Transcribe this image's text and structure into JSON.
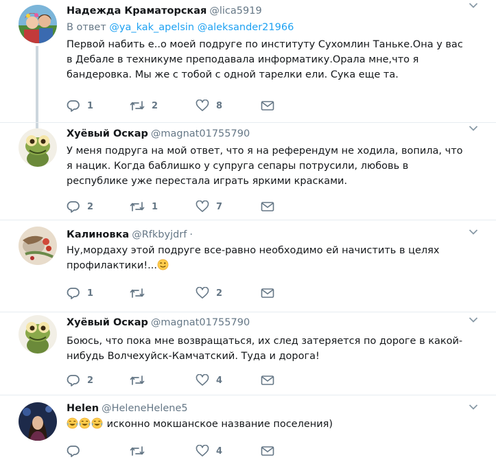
{
  "tweets": [
    {
      "name": "Надежда Краматорская",
      "handle": "@lica5919",
      "reply_prefix": "В ответ",
      "mentions": [
        "@ya_kak_apelsin",
        "@aleksander21966"
      ],
      "text": "Первой набить е..о моей подруге по институту Сухомлин Таньке.Она у вас в Дебале в техникуме преподавала информатику.Орала мне,что я бандеровка. Мы же с тобой с одной тарелки ели. Сука еще та.",
      "replies": "1",
      "retweets": "2",
      "likes": "8"
    },
    {
      "name": "Хуёвый Оскар",
      "handle": "@magnat01755790",
      "text": "У меня подруга на мой ответ, что я на референдум не ходила, вопила, что я нацик. Когда баблишко у супруга сепары потрусили, любовь в республике уже перестала играть яркими красками.",
      "replies": "2",
      "retweets": "1",
      "likes": "7"
    },
    {
      "name": "Калиновка",
      "handle": "@Rfkbyjdrf",
      "dot": "·",
      "text": "Ну,мордаху этой подруге все-равно необходимо ей начистить в целях профилактики!...",
      "emoji": "wink-face",
      "replies": "1",
      "retweets": "",
      "likes": "2"
    },
    {
      "name": "Хуёвый Оскар",
      "handle": "@magnat01755790",
      "text": "Боюсь, что пока мне возвращаться, их след затеряется по дороге в какой-нибудь Волчехуйск-Камчатский. Туда и дорога!",
      "replies": "2",
      "retweets": "",
      "likes": "4"
    },
    {
      "name": "Helen",
      "handle": "@HeleneHelene5",
      "emoji": "crying-laughing-face",
      "text": " исконно мокшанское название поселения)",
      "replies": "",
      "retweets": "",
      "likes": "4"
    }
  ],
  "colors": {
    "link": "#1da1f2",
    "muted": "#657786",
    "connector": "#ccd6dd",
    "separator": "#e6ecf0"
  }
}
